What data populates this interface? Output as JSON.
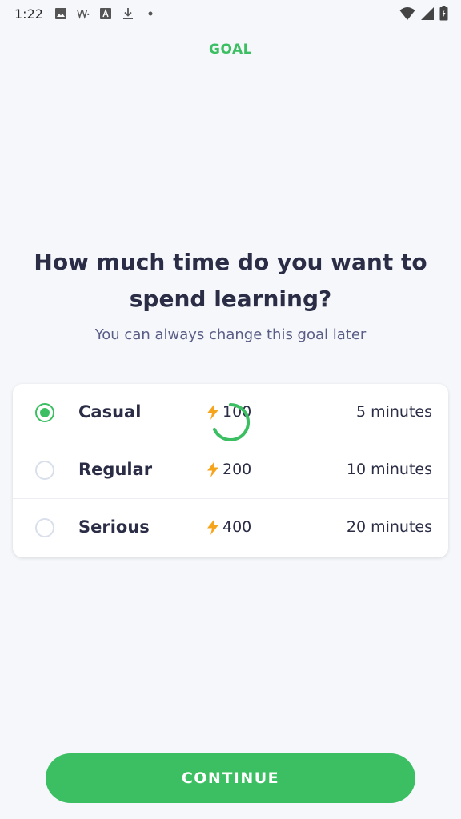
{
  "status_bar": {
    "time": "1:22",
    "left_icons": [
      "image-icon",
      "voicemail-icon",
      "a-square-icon",
      "download-icon",
      "dot-icon"
    ],
    "right_icons": [
      "wifi-icon",
      "cell-signal-icon",
      "battery-icon"
    ]
  },
  "header": {
    "title": "GOAL"
  },
  "question": {
    "title": "How much time do you want to spend learning?",
    "subtitle": "You can always change this goal later"
  },
  "options": [
    {
      "label": "Casual",
      "xp": "100",
      "time": "5 minutes",
      "selected": true
    },
    {
      "label": "Regular",
      "xp": "200",
      "time": "10 minutes",
      "selected": false
    },
    {
      "label": "Serious",
      "xp": "400",
      "time": "20 minutes",
      "selected": false
    }
  ],
  "continue_button": {
    "label": "CONTINUE"
  },
  "colors": {
    "accent": "#3cbf62",
    "background": "#f5f7fb",
    "bolt": "#f7a41d",
    "text": "#2a2d45",
    "subtitle": "#5a5d86"
  }
}
